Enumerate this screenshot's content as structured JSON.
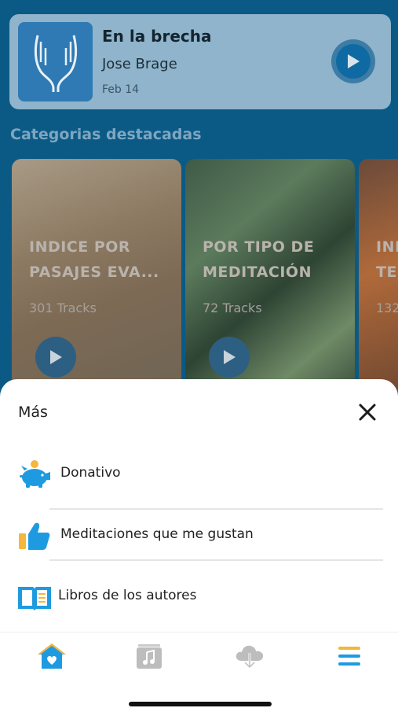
{
  "featured": {
    "title": "En la brecha",
    "author": "Jose Brage",
    "date": "Feb 14"
  },
  "section_title": "Categorias destacadas",
  "categories": [
    {
      "label": "INDICE POR\nPASAJES EVA...",
      "count": "301 Tracks"
    },
    {
      "label": "POR TIPO DE\nMEDITACIÓN",
      "count": "72 Tracks"
    },
    {
      "label": "INI\nTE",
      "count": "132"
    }
  ],
  "sheet": {
    "title": "Más",
    "items": [
      {
        "label": "Donativo",
        "icon": "piggy-bank-icon"
      },
      {
        "label": "Meditaciones que me gustan",
        "icon": "thumbs-up-icon"
      },
      {
        "label": "Libros de los autores",
        "icon": "open-book-icon"
      }
    ]
  },
  "nav": {
    "items": [
      "home-icon",
      "music-library-icon",
      "cloud-download-icon",
      "menu-icon"
    ]
  },
  "colors": {
    "accent": "#1e9be0",
    "accent_yellow": "#f4b73c",
    "app_bg": "#0b5a86"
  }
}
